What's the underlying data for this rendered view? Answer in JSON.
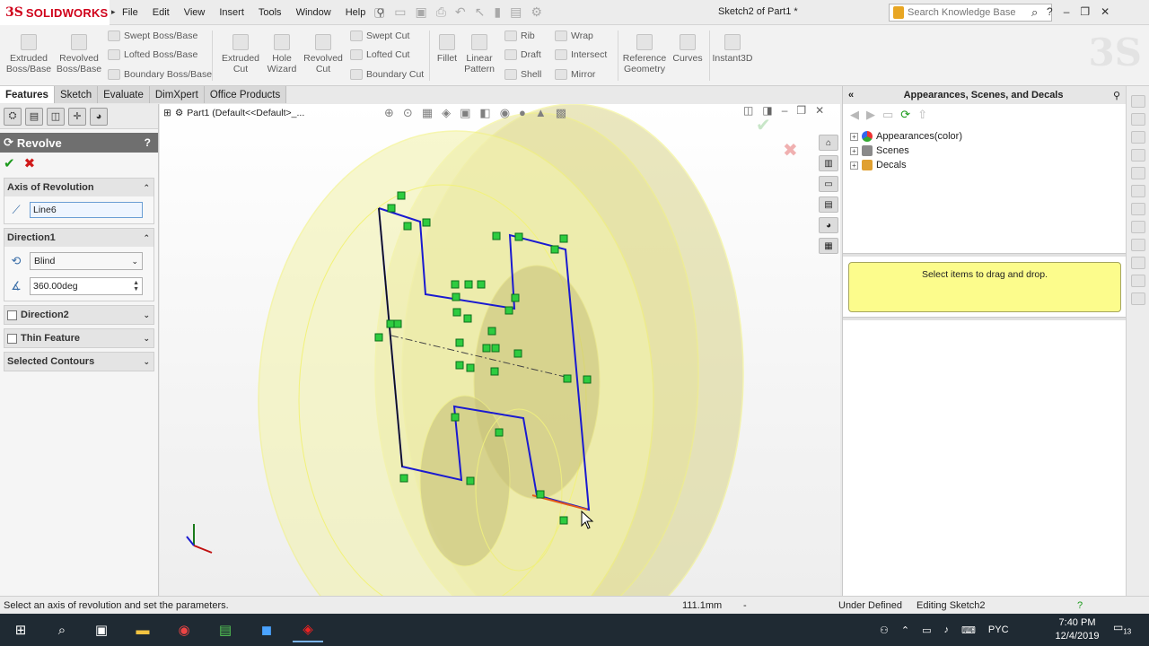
{
  "app": {
    "logo_ds": "3S",
    "logo_name": "SOLIDWORKS",
    "document_title": "Sketch2 of Part1 *",
    "menu": [
      "File",
      "Edit",
      "View",
      "Insert",
      "Tools",
      "Window",
      "Help"
    ],
    "kb_search_placeholder": "Search Knowledge Base"
  },
  "ribbon": {
    "extruded_boss": "Extruded Boss/Base",
    "revolved_boss": "Revolved Boss/Base",
    "swept_boss": "Swept Boss/Base",
    "lofted_boss": "Lofted Boss/Base",
    "boundary_boss": "Boundary Boss/Base",
    "extruded_cut": "Extruded Cut",
    "hole_wizard": "Hole Wizard",
    "revolved_cut": "Revolved Cut",
    "swept_cut": "Swept Cut",
    "lofted_cut": "Lofted Cut",
    "boundary_cut": "Boundary Cut",
    "fillet": "Fillet",
    "linear_pattern": "Linear Pattern",
    "rib": "Rib",
    "draft": "Draft",
    "shell": "Shell",
    "wrap": "Wrap",
    "intersect": "Intersect",
    "mirror": "Mirror",
    "reference_geometry": "Reference Geometry",
    "curves": "Curves",
    "instant3d": "Instant3D"
  },
  "tabs": [
    "Features",
    "Sketch",
    "Evaluate",
    "DimXpert",
    "Office Products"
  ],
  "property_manager": {
    "title": "Revolve",
    "help": "?",
    "axis_group": "Axis of Revolution",
    "axis_value": "Line6",
    "direction1_group": "Direction1",
    "end_condition": "Blind",
    "angle": "360.00deg",
    "direction2_group": "Direction2",
    "thin_feature_group": "Thin Feature",
    "selected_contours_group": "Selected Contours"
  },
  "graphics": {
    "feature_tree_label": "Part1  (Default<<Default>_..."
  },
  "task_pane": {
    "title": "Appearances, Scenes, and Decals",
    "tree": [
      "Appearances(color)",
      "Scenes",
      "Decals"
    ],
    "hint": "Select items to drag and drop."
  },
  "status": {
    "message": "Select an axis of revolution and set the parameters.",
    "measure": "111.1mm",
    "dash": "-",
    "state": "Under Defined",
    "editing": "Editing Sketch2"
  },
  "taskbar": {
    "lang": "PYC",
    "time": "7:40 PM",
    "date": "12/4/2019",
    "notifications": "13"
  },
  "colors": {
    "brand_red": "#d0021b",
    "sketch_blue": "#1a1ad0",
    "relation_green": "#2ecc40",
    "part_yellow": "#f3f3b0"
  }
}
